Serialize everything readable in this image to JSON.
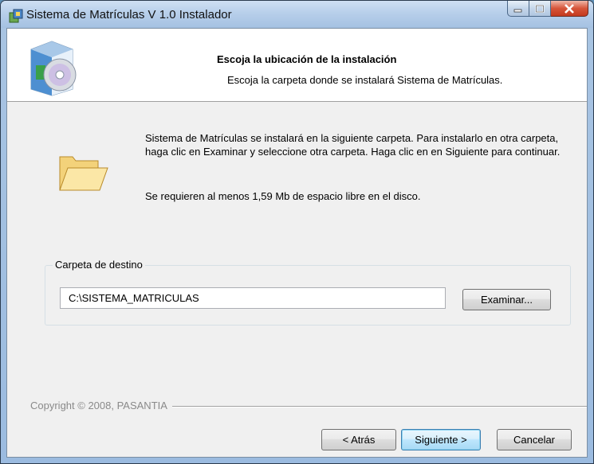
{
  "window": {
    "title": "Sistema de Matrículas V 1.0 Instalador"
  },
  "header": {
    "title": "Escoja la ubicación de la instalación",
    "subtitle": "Escoja la carpeta donde se instalará Sistema de Matrículas."
  },
  "body": {
    "description": "Sistema de Matrículas se instalará en la siguiente carpeta. Para instalarlo en otra carpeta, haga clic en Examinar y seleccione otra carpeta. Haga clic en en Siguiente para continuar.",
    "space_required": "Se requieren al menos 1,59 Mb de espacio libre en el disco."
  },
  "destination": {
    "group_label": "Carpeta de destino",
    "path": "C:\\SISTEMA_MATRICULAS",
    "browse_label": "Examinar..."
  },
  "footer": {
    "copyright": "Copyright © 2008, PASANTIA",
    "back_label": "< Atrás",
    "next_label": "Siguiente >",
    "cancel_label": "Cancelar"
  },
  "icons": {
    "app": "installer-app-icon",
    "header": "software-box-cd-icon",
    "folder": "folder-icon",
    "minimize": "minimize-icon",
    "maximize": "maximize-icon",
    "close": "close-icon"
  }
}
